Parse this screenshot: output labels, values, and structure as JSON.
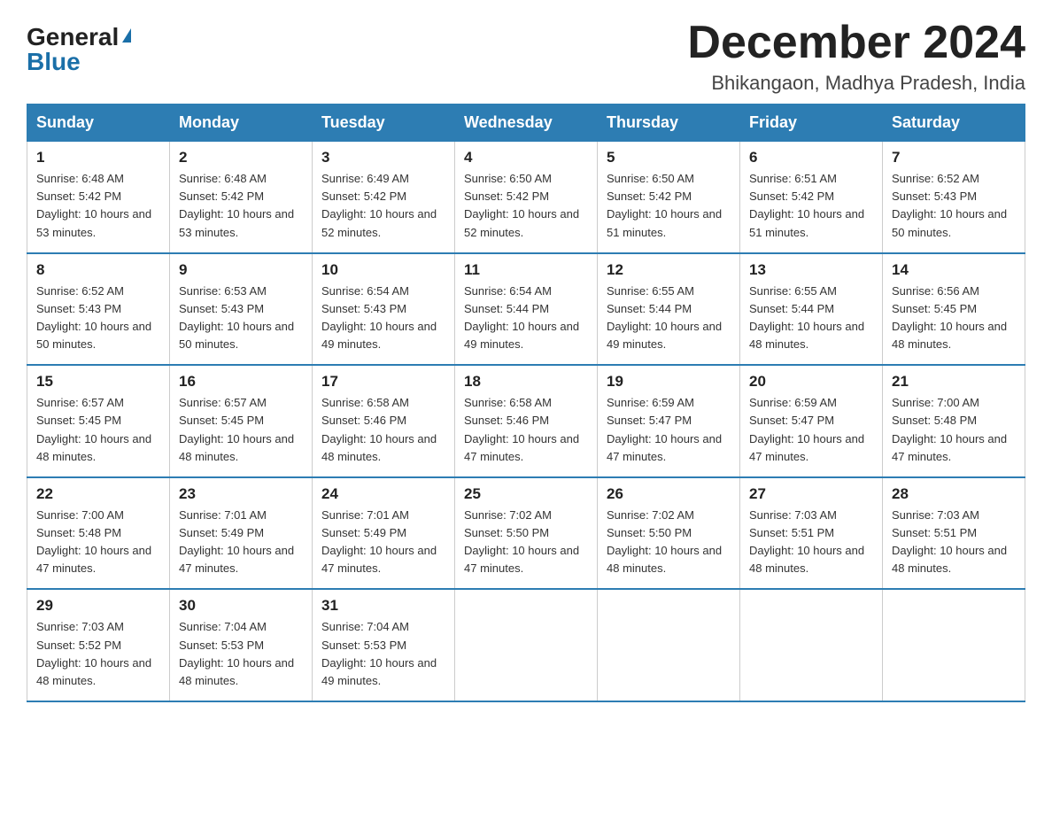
{
  "logo": {
    "general": "General",
    "blue": "Blue"
  },
  "title": {
    "month": "December 2024",
    "location": "Bhikangaon, Madhya Pradesh, India"
  },
  "headers": [
    "Sunday",
    "Monday",
    "Tuesday",
    "Wednesday",
    "Thursday",
    "Friday",
    "Saturday"
  ],
  "weeks": [
    [
      {
        "day": "1",
        "sunrise": "6:48 AM",
        "sunset": "5:42 PM",
        "daylight": "10 hours and 53 minutes."
      },
      {
        "day": "2",
        "sunrise": "6:48 AM",
        "sunset": "5:42 PM",
        "daylight": "10 hours and 53 minutes."
      },
      {
        "day": "3",
        "sunrise": "6:49 AM",
        "sunset": "5:42 PM",
        "daylight": "10 hours and 52 minutes."
      },
      {
        "day": "4",
        "sunrise": "6:50 AM",
        "sunset": "5:42 PM",
        "daylight": "10 hours and 52 minutes."
      },
      {
        "day": "5",
        "sunrise": "6:50 AM",
        "sunset": "5:42 PM",
        "daylight": "10 hours and 51 minutes."
      },
      {
        "day": "6",
        "sunrise": "6:51 AM",
        "sunset": "5:42 PM",
        "daylight": "10 hours and 51 minutes."
      },
      {
        "day": "7",
        "sunrise": "6:52 AM",
        "sunset": "5:43 PM",
        "daylight": "10 hours and 50 minutes."
      }
    ],
    [
      {
        "day": "8",
        "sunrise": "6:52 AM",
        "sunset": "5:43 PM",
        "daylight": "10 hours and 50 minutes."
      },
      {
        "day": "9",
        "sunrise": "6:53 AM",
        "sunset": "5:43 PM",
        "daylight": "10 hours and 50 minutes."
      },
      {
        "day": "10",
        "sunrise": "6:54 AM",
        "sunset": "5:43 PM",
        "daylight": "10 hours and 49 minutes."
      },
      {
        "day": "11",
        "sunrise": "6:54 AM",
        "sunset": "5:44 PM",
        "daylight": "10 hours and 49 minutes."
      },
      {
        "day": "12",
        "sunrise": "6:55 AM",
        "sunset": "5:44 PM",
        "daylight": "10 hours and 49 minutes."
      },
      {
        "day": "13",
        "sunrise": "6:55 AM",
        "sunset": "5:44 PM",
        "daylight": "10 hours and 48 minutes."
      },
      {
        "day": "14",
        "sunrise": "6:56 AM",
        "sunset": "5:45 PM",
        "daylight": "10 hours and 48 minutes."
      }
    ],
    [
      {
        "day": "15",
        "sunrise": "6:57 AM",
        "sunset": "5:45 PM",
        "daylight": "10 hours and 48 minutes."
      },
      {
        "day": "16",
        "sunrise": "6:57 AM",
        "sunset": "5:45 PM",
        "daylight": "10 hours and 48 minutes."
      },
      {
        "day": "17",
        "sunrise": "6:58 AM",
        "sunset": "5:46 PM",
        "daylight": "10 hours and 48 minutes."
      },
      {
        "day": "18",
        "sunrise": "6:58 AM",
        "sunset": "5:46 PM",
        "daylight": "10 hours and 47 minutes."
      },
      {
        "day": "19",
        "sunrise": "6:59 AM",
        "sunset": "5:47 PM",
        "daylight": "10 hours and 47 minutes."
      },
      {
        "day": "20",
        "sunrise": "6:59 AM",
        "sunset": "5:47 PM",
        "daylight": "10 hours and 47 minutes."
      },
      {
        "day": "21",
        "sunrise": "7:00 AM",
        "sunset": "5:48 PM",
        "daylight": "10 hours and 47 minutes."
      }
    ],
    [
      {
        "day": "22",
        "sunrise": "7:00 AM",
        "sunset": "5:48 PM",
        "daylight": "10 hours and 47 minutes."
      },
      {
        "day": "23",
        "sunrise": "7:01 AM",
        "sunset": "5:49 PM",
        "daylight": "10 hours and 47 minutes."
      },
      {
        "day": "24",
        "sunrise": "7:01 AM",
        "sunset": "5:49 PM",
        "daylight": "10 hours and 47 minutes."
      },
      {
        "day": "25",
        "sunrise": "7:02 AM",
        "sunset": "5:50 PM",
        "daylight": "10 hours and 47 minutes."
      },
      {
        "day": "26",
        "sunrise": "7:02 AM",
        "sunset": "5:50 PM",
        "daylight": "10 hours and 48 minutes."
      },
      {
        "day": "27",
        "sunrise": "7:03 AM",
        "sunset": "5:51 PM",
        "daylight": "10 hours and 48 minutes."
      },
      {
        "day": "28",
        "sunrise": "7:03 AM",
        "sunset": "5:51 PM",
        "daylight": "10 hours and 48 minutes."
      }
    ],
    [
      {
        "day": "29",
        "sunrise": "7:03 AM",
        "sunset": "5:52 PM",
        "daylight": "10 hours and 48 minutes."
      },
      {
        "day": "30",
        "sunrise": "7:04 AM",
        "sunset": "5:53 PM",
        "daylight": "10 hours and 48 minutes."
      },
      {
        "day": "31",
        "sunrise": "7:04 AM",
        "sunset": "5:53 PM",
        "daylight": "10 hours and 49 minutes."
      },
      null,
      null,
      null,
      null
    ]
  ],
  "labels": {
    "sunrise": "Sunrise: ",
    "sunset": "Sunset: ",
    "daylight": "Daylight: "
  }
}
